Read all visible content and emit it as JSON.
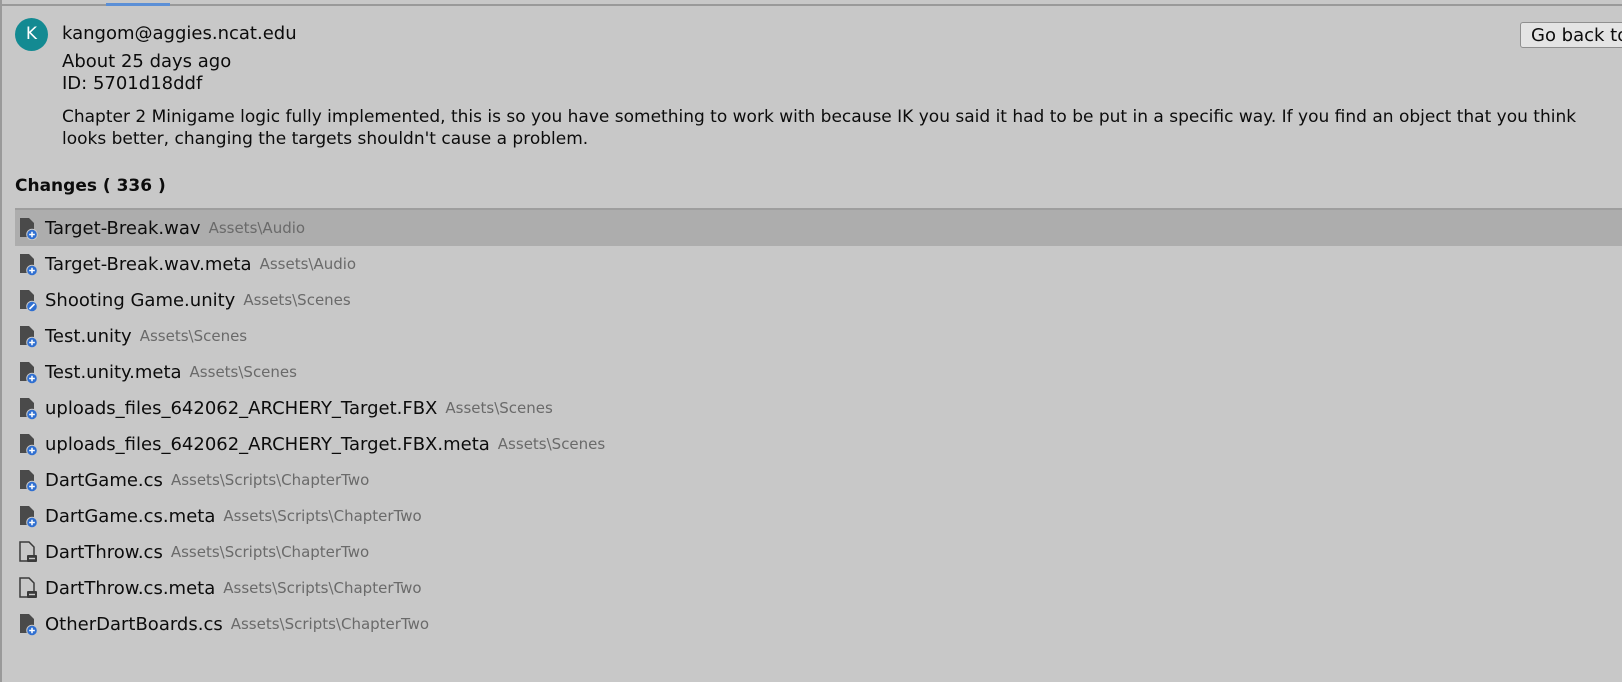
{
  "commit": {
    "avatar_letter": "K",
    "author": "kangom@aggies.ncat.edu",
    "date": "About 25 days ago",
    "id_label": "ID: 5701d18ddf",
    "message": "Chapter 2 Minigame logic fully implemented, this is so you have something to work with because IK you said it had to be put in a specific way. If you find an object that you think looks better, changing the targets shouldn't cause a problem.",
    "go_back_label": "Go back to"
  },
  "changes": {
    "header": "Changes ( 336 )",
    "items": [
      {
        "name": "Target-Break.wav",
        "path": "Assets\\Audio",
        "status": "added",
        "selected": true
      },
      {
        "name": "Target-Break.wav.meta",
        "path": "Assets\\Audio",
        "status": "added"
      },
      {
        "name": "Shooting Game.unity",
        "path": "Assets\\Scenes",
        "status": "modified"
      },
      {
        "name": "Test.unity",
        "path": "Assets\\Scenes",
        "status": "added"
      },
      {
        "name": "Test.unity.meta",
        "path": "Assets\\Scenes",
        "status": "added"
      },
      {
        "name": "uploads_files_642062_ARCHERY_Target.FBX",
        "path": "Assets\\Scenes",
        "status": "added"
      },
      {
        "name": "uploads_files_642062_ARCHERY_Target.FBX.meta",
        "path": "Assets\\Scenes",
        "status": "added"
      },
      {
        "name": "DartGame.cs",
        "path": "Assets\\Scripts\\ChapterTwo",
        "status": "added"
      },
      {
        "name": "DartGame.cs.meta",
        "path": "Assets\\Scripts\\ChapterTwo",
        "status": "added"
      },
      {
        "name": "DartThrow.cs",
        "path": "Assets\\Scripts\\ChapterTwo",
        "status": "deleted"
      },
      {
        "name": "DartThrow.cs.meta",
        "path": "Assets\\Scripts\\ChapterTwo",
        "status": "deleted"
      },
      {
        "name": "OtherDartBoards.cs",
        "path": "Assets\\Scripts\\ChapterTwo",
        "status": "added"
      }
    ]
  },
  "colors": {
    "background": "#c8c8c8",
    "selected_row": "#adadad",
    "avatar": "#138a92",
    "added_badge": "#2f6fd1",
    "path_text": "#6a6a6a"
  }
}
